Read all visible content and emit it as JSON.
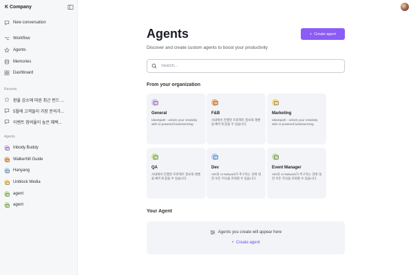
{
  "sidebar": {
    "company": "K Company",
    "new_conversation": "New conversation",
    "nav": [
      {
        "label": "Workflow",
        "icon": "workflow-icon"
      },
      {
        "label": "Agents",
        "icon": "star-icon"
      },
      {
        "label": "Memories",
        "icon": "memory-icon"
      },
      {
        "label": "Dashboard",
        "icon": "dashboard-icon"
      }
    ],
    "recents_label": "Recents",
    "recents": [
      {
        "label": "환율 감소에 따른 최근 펀드 ...",
        "icon": "loading-icon"
      },
      {
        "label": "5월에 고객들이 가장 문의가...",
        "icon": "chat-icon"
      },
      {
        "label": "이벤트 참여율이 높은 혜택...",
        "icon": "chat-icon"
      }
    ],
    "agents_label": "Agents",
    "agents": [
      {
        "label": "Inbody Buddy",
        "color": "#d9c6f2"
      },
      {
        "label": "Walkerhill Guide",
        "color": "#f3b98a"
      },
      {
        "label": "Hanyang",
        "color": "#b9d4f2"
      },
      {
        "label": "Unblock Media",
        "color": "#f5dc8c"
      },
      {
        "label": "agent",
        "color": "#c5e0a5"
      },
      {
        "label": "agent",
        "color": "#c5e0a5"
      }
    ]
  },
  "header": {
    "title": "Agents",
    "subtitle": "Discover and create custom agents to boost your productivity",
    "create_label": "Create agent"
  },
  "search": {
    "placeholder": "Search..."
  },
  "org": {
    "title": "From your organization",
    "cards": [
      {
        "name": "General",
        "desc": "IdeaSpark - unlock your creativity with AI-powered brainstorming.",
        "color": "#d9c6f2"
      },
      {
        "name": "F&B",
        "desc": "사내에서 진행된 프로젝트 정보와 레벤을 빠르게 찾을 수 있습니다.",
        "color": "#f3b98a"
      },
      {
        "name": "Marketing",
        "desc": "IdeaSpark - unlock your creativity with AI-powered brainstorming.",
        "color": "#f5dc8c"
      },
      {
        "name": "QA",
        "desc": "사내에서 진행된 프로젝트 정보와 레벤을 빠르게 찾을 수 있습니다.",
        "color": "#c5e0a5"
      },
      {
        "name": "Dev",
        "desc": "AIN과 AI Network가 추구하는 것에 대한 모든 지식을 조회할 수 있습니다.",
        "color": "#b9d4f2"
      },
      {
        "name": "Event Manager",
        "desc": "AIN과 AI Network가 추구하는 것에 대한 모든 지식을 조회할 수 있습니다.",
        "color": "#c5e0a5"
      }
    ]
  },
  "your_agent": {
    "title": "Your Agent",
    "empty_message": "Agents you create will appear here",
    "create_label": "Create agent"
  },
  "colors": {
    "accent": "#8b5cf6",
    "link": "#6d4fe0"
  }
}
